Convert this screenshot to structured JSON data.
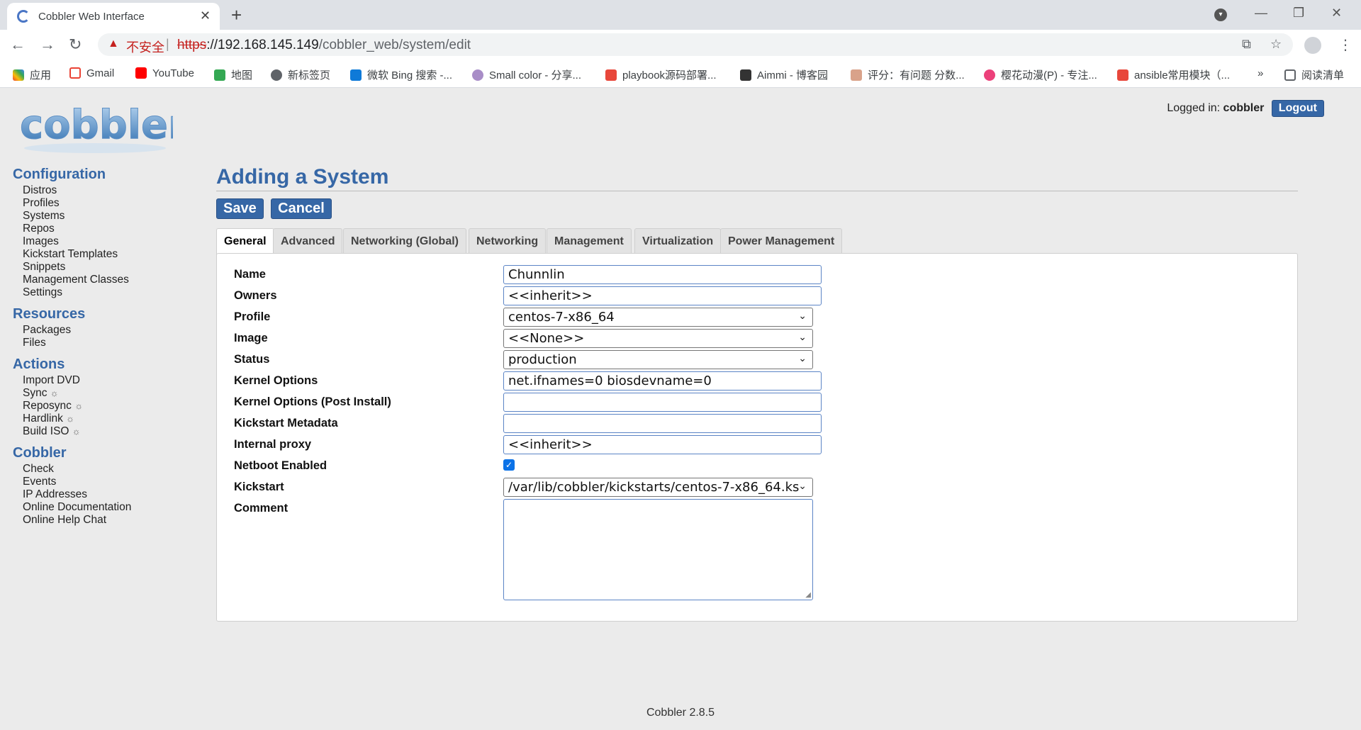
{
  "browser": {
    "tab_title": "Cobbler Web Interface",
    "insecure_label": "不安全",
    "url_scheme": "https",
    "url_host": "://192.168.145.149",
    "url_path": "/cobbler_web/system/edit",
    "bookmarks": [
      "应用",
      "Gmail",
      "YouTube",
      "地图",
      "新标签页",
      "微软 Bing 搜索 -...",
      "Small color - 分享...",
      "playbook源码部署...",
      "Aimmi - 博客园",
      "评分：有问题 分数...",
      "樱花动漫(P) - 专注...",
      "ansible常用模块（...",
      "»",
      "阅读清单"
    ]
  },
  "header": {
    "logged_in_label": "Logged in:",
    "username": "cobbler",
    "logout_label": "Logout",
    "logo_text": "cobbler"
  },
  "sidebar": {
    "configuration": {
      "title": "Configuration",
      "items": [
        "Distros",
        "Profiles",
        "Systems",
        "Repos",
        "Images",
        "Kickstart Templates",
        "Snippets",
        "Management Classes",
        "Settings"
      ]
    },
    "resources": {
      "title": "Resources",
      "items": [
        "Packages",
        "Files"
      ]
    },
    "actions": {
      "title": "Actions",
      "items": [
        "Import DVD",
        "Sync",
        "Reposync",
        "Hardlink",
        "Build ISO"
      ],
      "gear": "☼"
    },
    "cobbler": {
      "title": "Cobbler",
      "items": [
        "Check",
        "Events",
        "IP Addresses",
        "Online Documentation",
        "Online Help Chat"
      ]
    }
  },
  "main": {
    "title": "Adding a System",
    "save_label": "Save",
    "cancel_label": "Cancel",
    "tabs": [
      "General",
      "Advanced",
      "Networking (Global)",
      "Networking",
      "Management",
      "Virtualization",
      "Power Management"
    ],
    "fields": {
      "name": {
        "label": "Name",
        "value": "Chunnlin"
      },
      "owners": {
        "label": "Owners",
        "value": "<<inherit>>"
      },
      "profile": {
        "label": "Profile",
        "value": "centos-7-x86_64"
      },
      "image": {
        "label": "Image",
        "value": "<<None>>"
      },
      "status": {
        "label": "Status",
        "value": "production"
      },
      "kernel_options": {
        "label": "Kernel Options",
        "value": "net.ifnames=0 biosdevname=0"
      },
      "kernel_options_post": {
        "label": "Kernel Options (Post Install)",
        "value": ""
      },
      "kickstart_metadata": {
        "label": "Kickstart Metadata",
        "value": ""
      },
      "internal_proxy": {
        "label": "Internal proxy",
        "value": "<<inherit>>"
      },
      "netboot_enabled": {
        "label": "Netboot Enabled",
        "checked": true
      },
      "kickstart": {
        "label": "Kickstart",
        "value": "/var/lib/cobbler/kickstarts/centos-7-x86_64.ks"
      },
      "comment": {
        "label": "Comment",
        "value": ""
      }
    }
  },
  "footer": {
    "version": "Cobbler 2.8.5"
  }
}
